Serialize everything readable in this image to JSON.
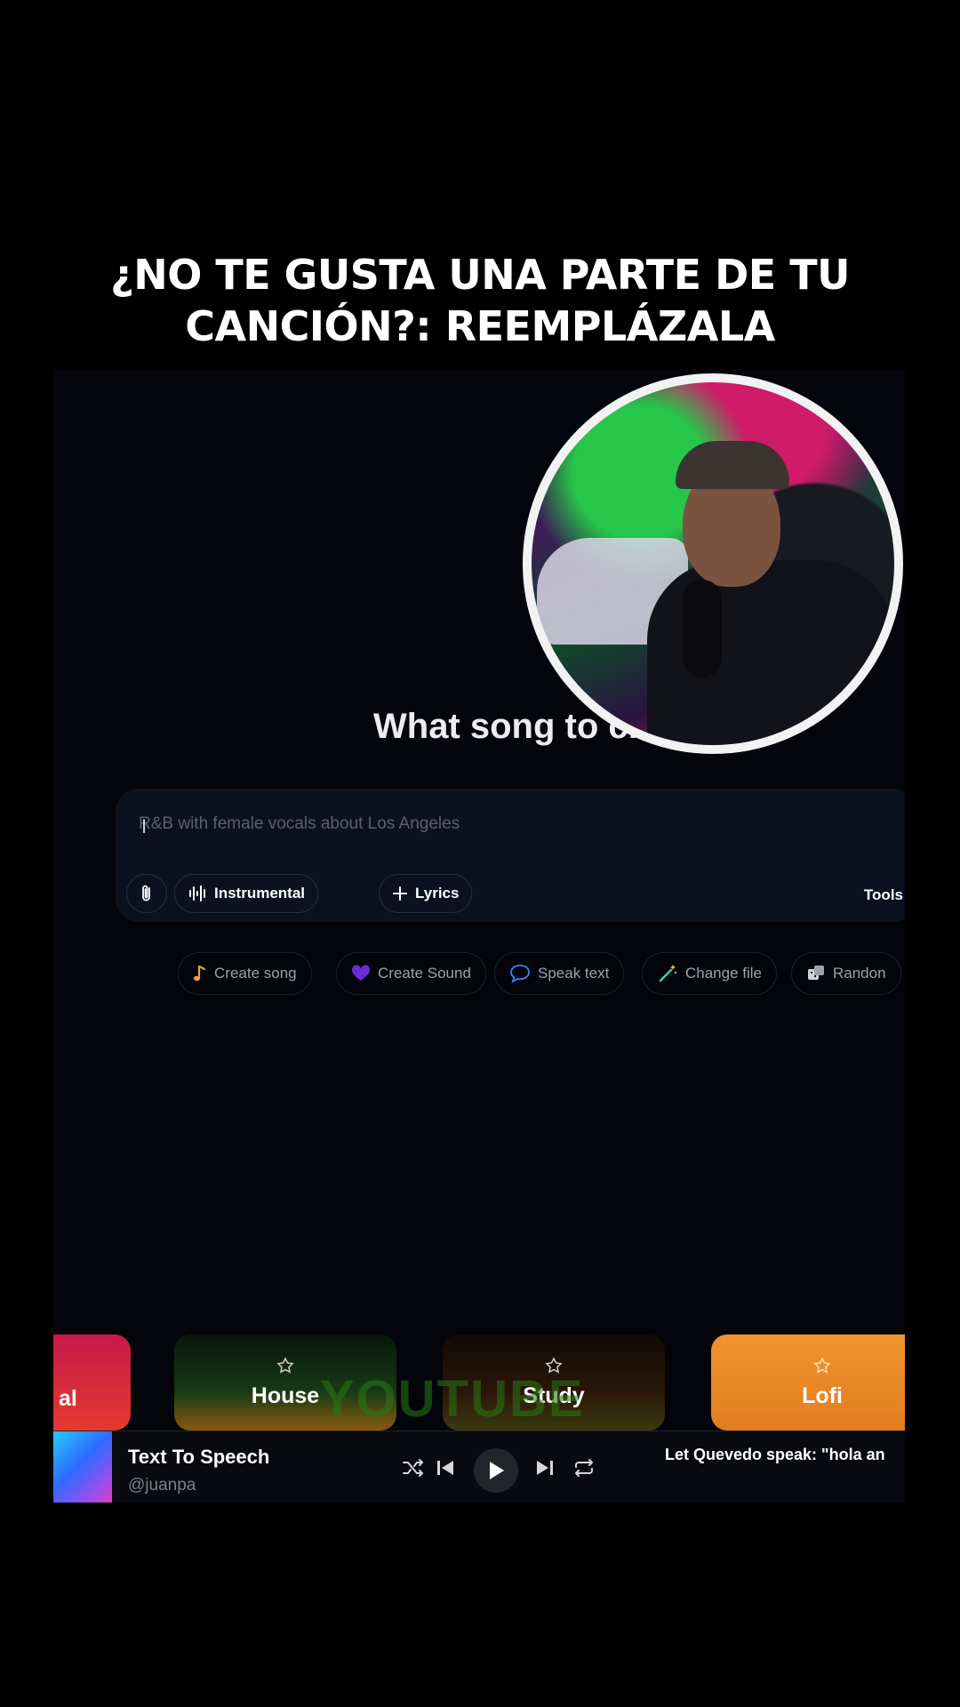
{
  "caption": {
    "line1": "¿NO TE GUSTA UNA PARTE DE TU",
    "line2": "CANCIÓN?: REEMPLÁZALA"
  },
  "main": {
    "headline": "What song to cr"
  },
  "composer": {
    "placeholder": "R&B with female vocals about Los Angeles",
    "instrumental_label": "Instrumental",
    "lyrics_label": "Lyrics",
    "tools_label": "Tools"
  },
  "suggestions": [
    {
      "label": "Create song",
      "icon": "music-note-icon",
      "color": "#e8a13a"
    },
    {
      "label": "Create Sound",
      "icon": "heart-icon",
      "color": "#6c2bd9"
    },
    {
      "label": "Speak text",
      "icon": "speech-bubble-icon",
      "color": "#3b82f6"
    },
    {
      "label": "Change file",
      "icon": "magic-wand-icon",
      "color": "#34d399"
    },
    {
      "label": "Randon",
      "icon": "dice-icon",
      "color": "#d1d5db"
    }
  ],
  "genre_cards": [
    {
      "label": "al"
    },
    {
      "label": "House"
    },
    {
      "label": "Study"
    },
    {
      "label": "Lofi"
    }
  ],
  "watermark": "YOUTUBE",
  "player": {
    "title": "Text To Speech",
    "user": "@juanpa",
    "now_playing": "Let Quevedo speak: \"hola an"
  }
}
